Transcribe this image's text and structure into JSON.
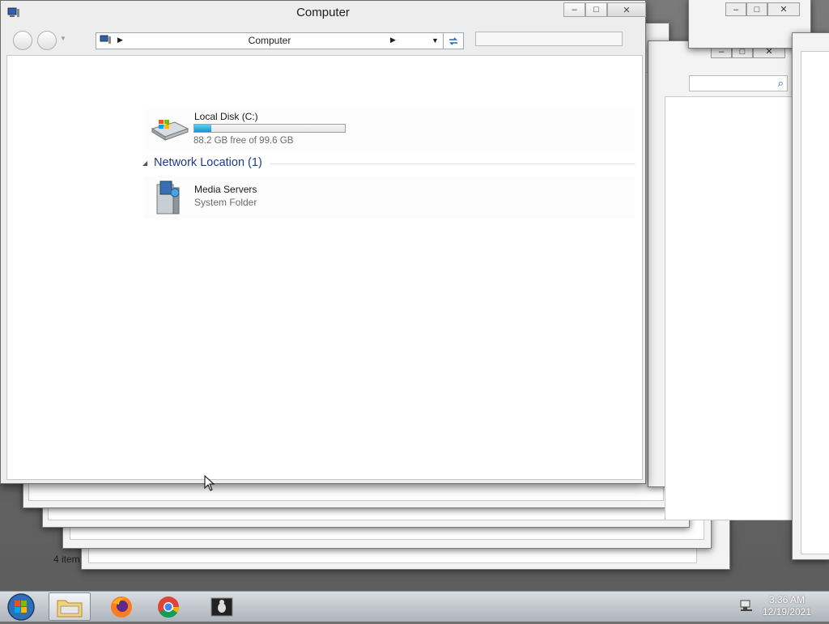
{
  "window": {
    "title": "Computer",
    "address": "Computer",
    "search_placeholder": ""
  },
  "drive": {
    "name": "Local Disk (C:)",
    "free_text": "88.2 GB free of 99.6 GB",
    "used_fraction": 0.114,
    "bar_color": "#29a3e0"
  },
  "network_group": {
    "header": "Network Location (1)"
  },
  "network_item": {
    "name": "Media Servers",
    "type": "System Folder"
  },
  "background_window": {
    "status": "4 item"
  },
  "taskbar": {
    "items": [
      "Windows Explorer",
      "Firefox",
      "Google Chrome",
      "Bug Reporter"
    ],
    "time": "3:36 AM",
    "date": "12/19/2021"
  },
  "icons": {
    "app": "computer-icon",
    "drive": "hard-drive-icon",
    "network": "media-server-icon",
    "start": "windows-logo-icon"
  }
}
